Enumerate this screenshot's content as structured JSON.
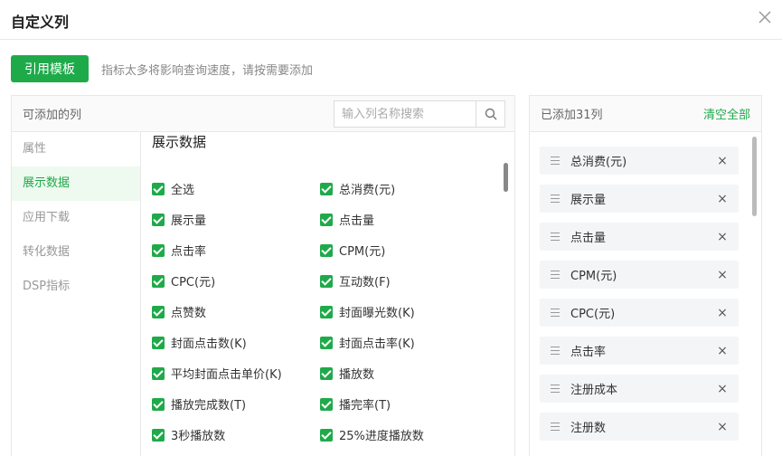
{
  "dialog": {
    "title": "自定义列"
  },
  "toolbar": {
    "template_button": "引用模板",
    "hint": "指标太多将影响查询速度，请按需要添加"
  },
  "left_panel": {
    "title": "可添加的列",
    "search_placeholder": "输入列名称搜索",
    "categories": [
      {
        "label": "属性",
        "active": false
      },
      {
        "label": "展示数据",
        "active": true
      },
      {
        "label": "应用下载",
        "active": false
      },
      {
        "label": "转化数据",
        "active": false
      },
      {
        "label": "DSP指标",
        "active": false
      }
    ],
    "section_title": "展示数据",
    "checkbox_rows": [
      [
        "全选",
        "总消费(元)"
      ],
      [
        "展示量",
        "点击量"
      ],
      [
        "点击率",
        "CPM(元)"
      ],
      [
        "CPC(元)",
        "互动数(F)"
      ],
      [
        "点赞数",
        "封面曝光数(K)"
      ],
      [
        "封面点击数(K)",
        "封面点击率(K)"
      ],
      [
        "平均封面点击单价(K)",
        "播放数"
      ],
      [
        "播放完成数(T)",
        "播完率(T)"
      ],
      [
        "3秒播放数",
        "25%进度播放数"
      ]
    ]
  },
  "right_panel": {
    "title": "已添加31列",
    "clear_all": "清空全部",
    "items": [
      "总消费(元)",
      "展示量",
      "点击量",
      "CPM(元)",
      "CPC(元)",
      "点击率",
      "注册成本",
      "注册数"
    ],
    "remove_symbol": "×"
  },
  "colors": {
    "accent": "#1faa4a",
    "active_bg": "#eef9ef"
  }
}
